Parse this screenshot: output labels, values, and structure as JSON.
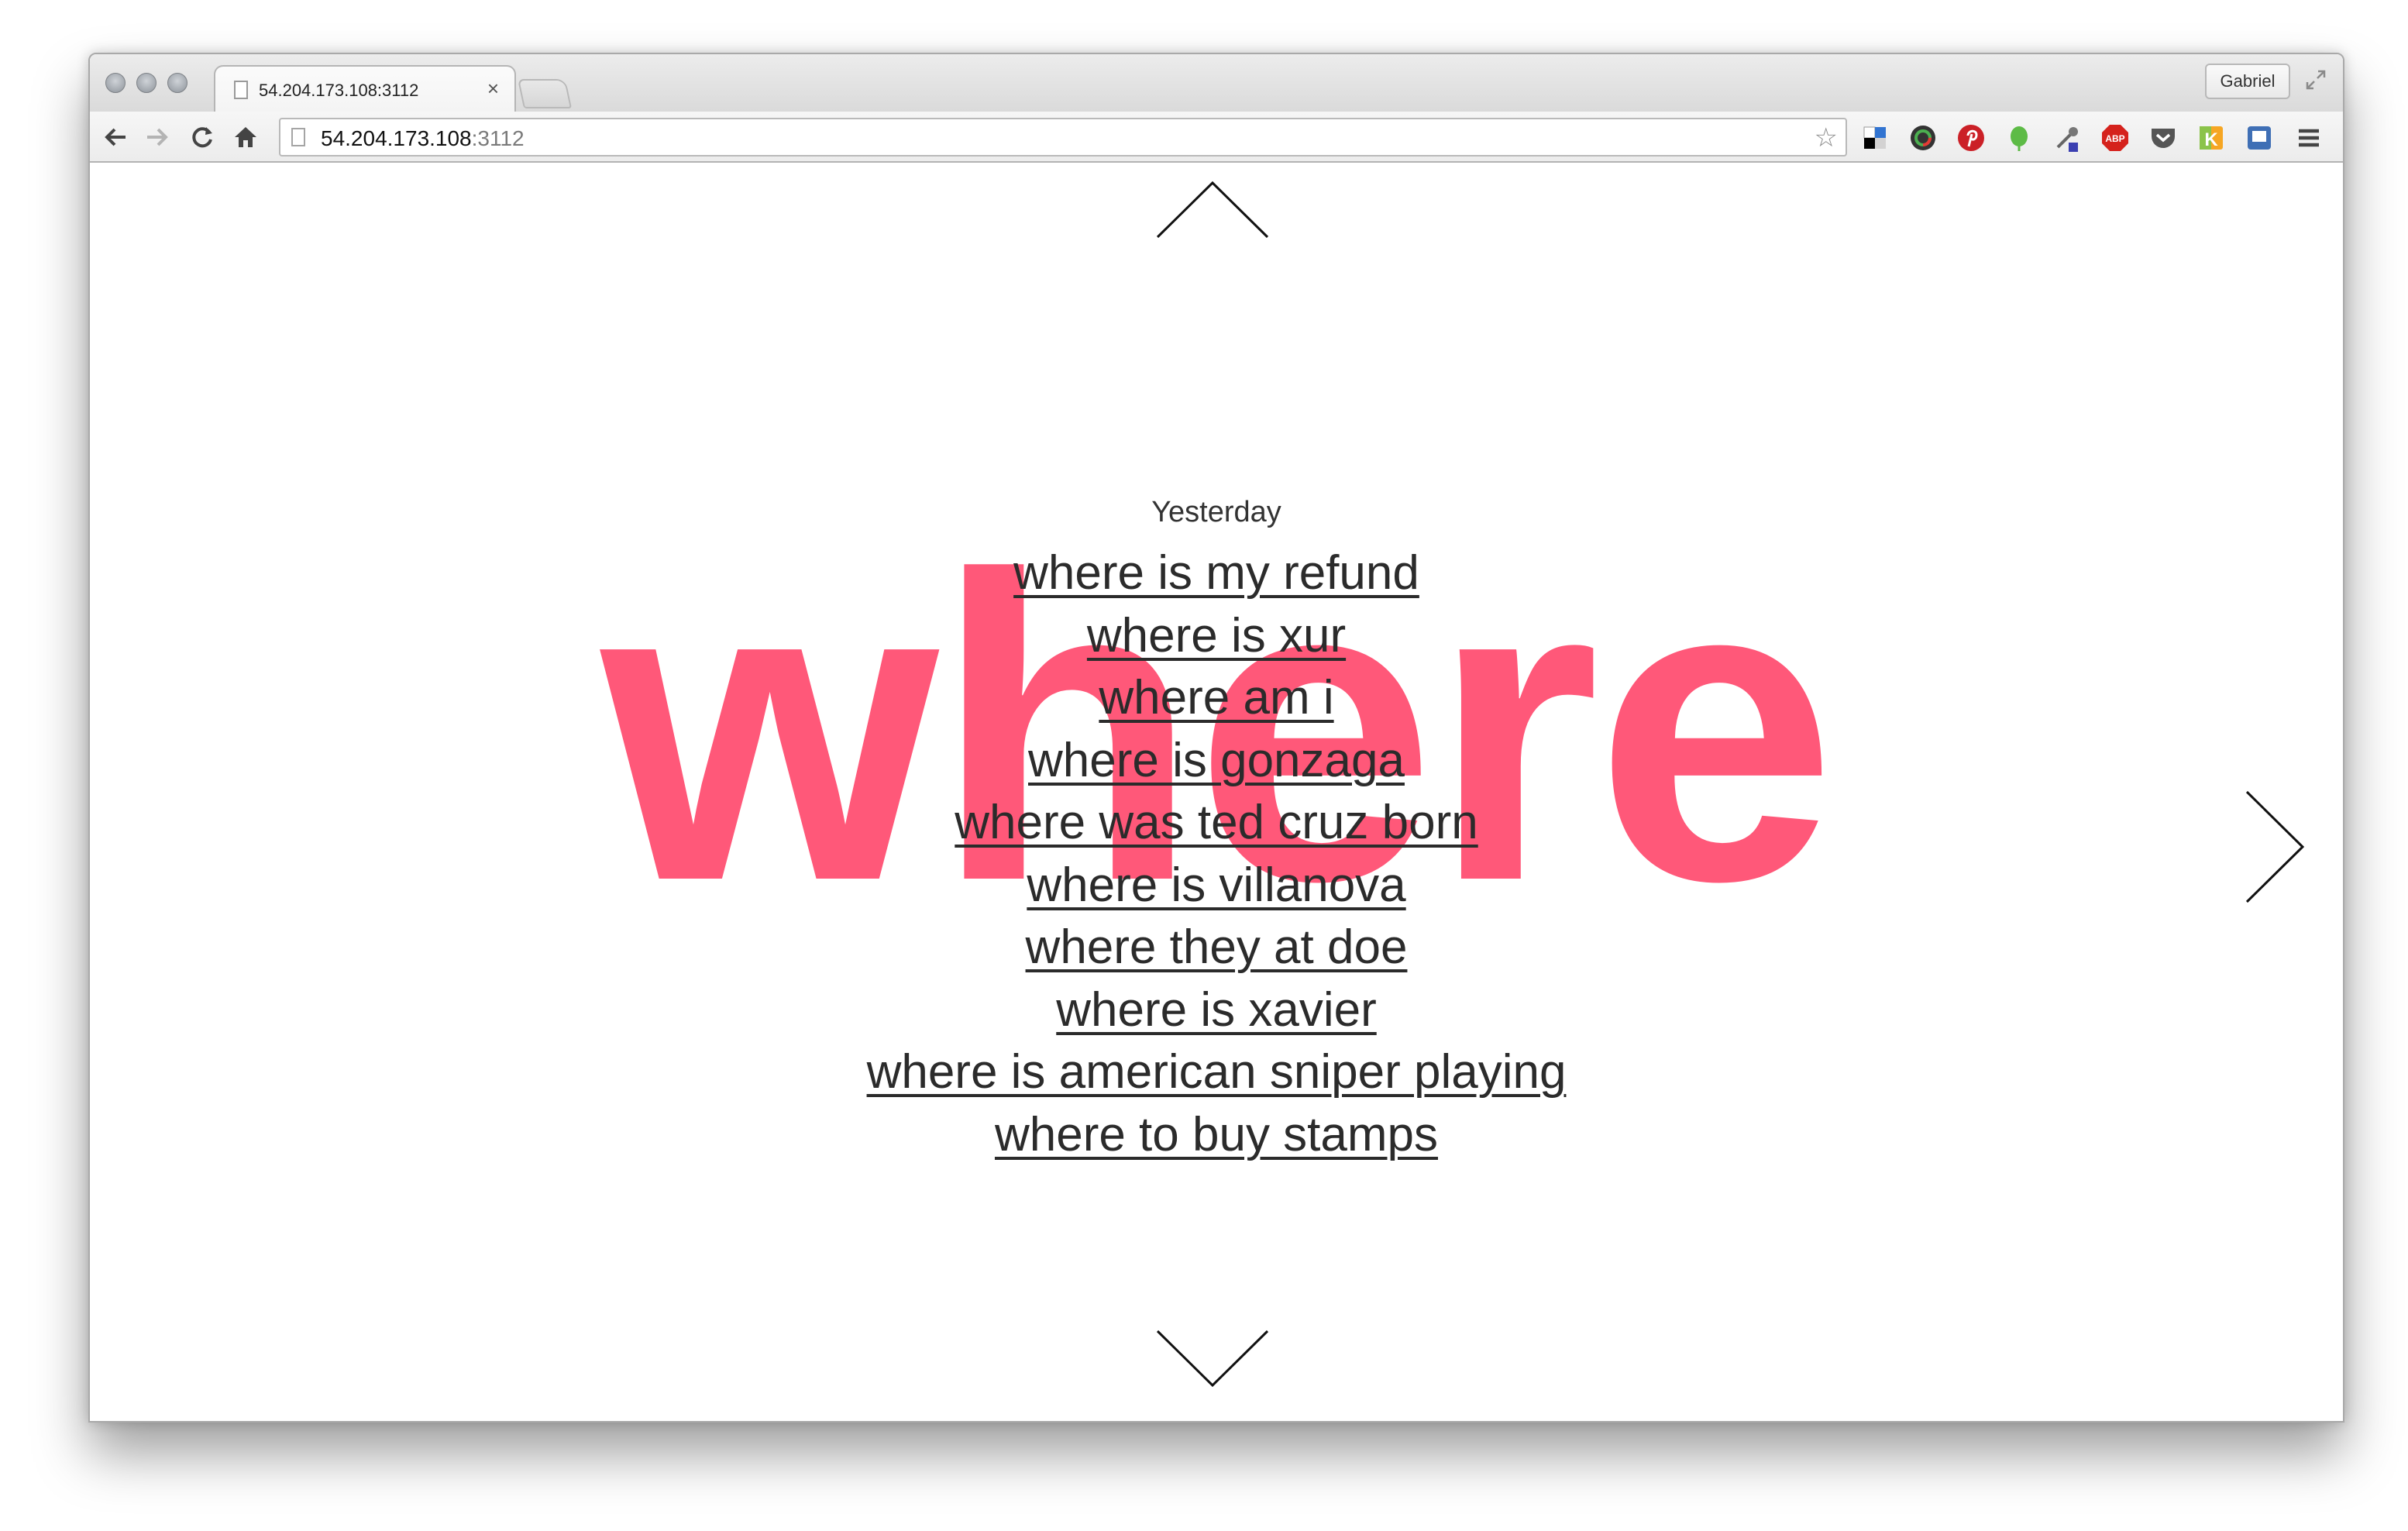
{
  "browser": {
    "tab_title": "54.204.173.108:3112",
    "tab_close": "×",
    "profile_label": "Gabriel",
    "url_host": "54.204.173.108",
    "url_port": ":3112",
    "bookmark_star": "☆"
  },
  "page": {
    "big_word": "where",
    "section_title": "Yesterday",
    "links": [
      "where is my refund",
      "where is xur",
      "where am i",
      "where is gonzaga",
      "where was ted cruz born",
      "where is villanova",
      "where they at doe",
      "where is xavier",
      "where is american sniper playing",
      "where to buy stamps"
    ]
  },
  "colors": {
    "accent": "#ff5879",
    "link_text": "#2b2b2b"
  },
  "icons": [
    "back-icon",
    "forward-icon",
    "reload-icon",
    "home-icon",
    "delicious-icon",
    "colorpicker-icon",
    "pinterest-icon",
    "evernote-icon",
    "eyedropper-icon",
    "adblock-plus-icon",
    "pocket-icon",
    "klout-icon",
    "extension-icon",
    "menu-icon",
    "up-arrow-icon",
    "down-arrow-icon",
    "right-arrow-icon"
  ]
}
